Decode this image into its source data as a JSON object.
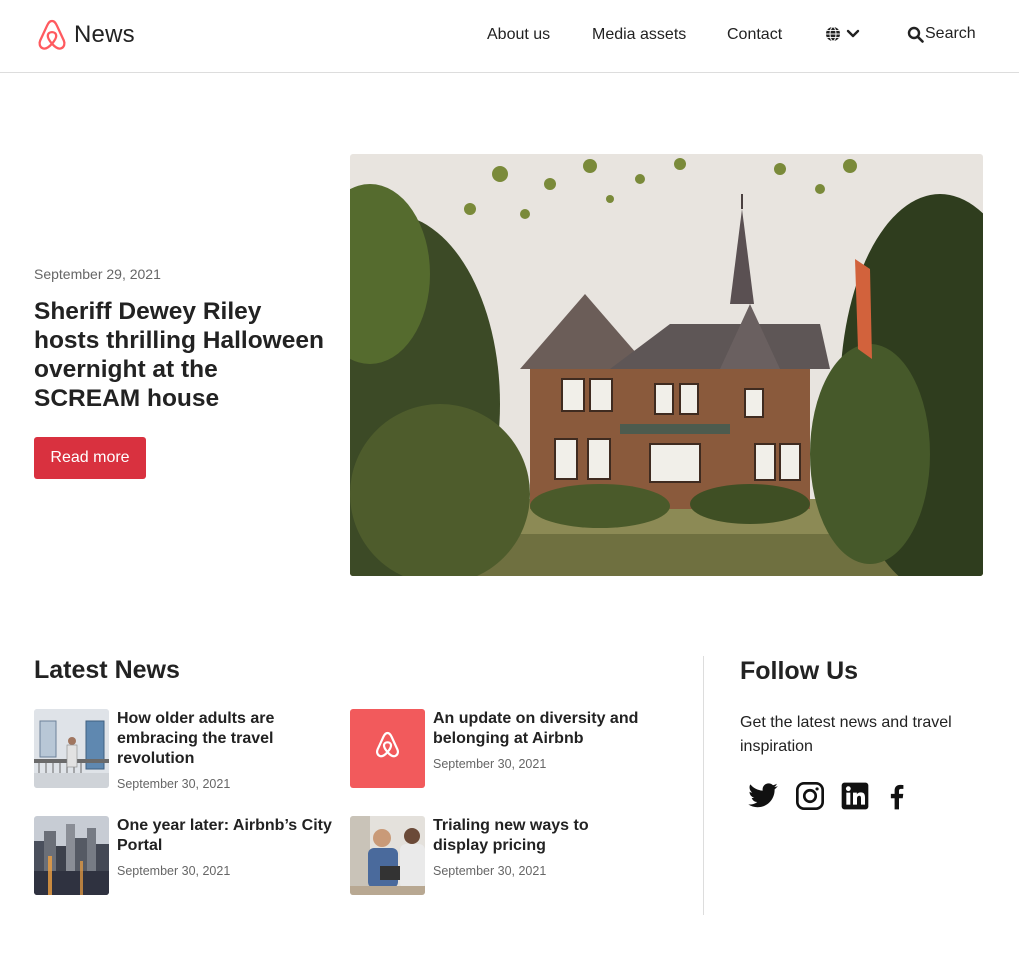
{
  "header": {
    "brand": "News",
    "nav": [
      {
        "label": "About us"
      },
      {
        "label": "Media assets"
      },
      {
        "label": "Contact"
      }
    ],
    "language_icon": "globe-icon",
    "search_label": "Search"
  },
  "hero": {
    "date": "September 29, 2021",
    "title": "Sheriff Dewey Riley hosts thrilling Halloween overnight at the SCREAM house",
    "button": "Read more"
  },
  "latest": {
    "title": "Latest News",
    "items": [
      {
        "title": "How older adults are embracing the travel revolution",
        "date": "September 30, 2021",
        "thumb": "balcony-photo"
      },
      {
        "title": "An update on diversity and belonging at Airbnb",
        "date": "September 30, 2021",
        "thumb": "airbnb-logo"
      },
      {
        "title": "One year later: Airbnb’s City Portal",
        "date": "September 30, 2021",
        "thumb": "city-skyline-photo"
      },
      {
        "title": "Trialing new ways to display pricing",
        "date": "September 30, 2021",
        "thumb": "people-meeting-photo"
      }
    ]
  },
  "follow": {
    "title": "Follow Us",
    "description": "Get the latest news and travel inspiration",
    "social": [
      "twitter-icon",
      "instagram-icon",
      "linkedin-icon",
      "facebook-icon"
    ]
  },
  "colors": {
    "brand": "#ff5a5f",
    "button": "#d9313f",
    "text": "#222222",
    "muted": "#666666"
  }
}
